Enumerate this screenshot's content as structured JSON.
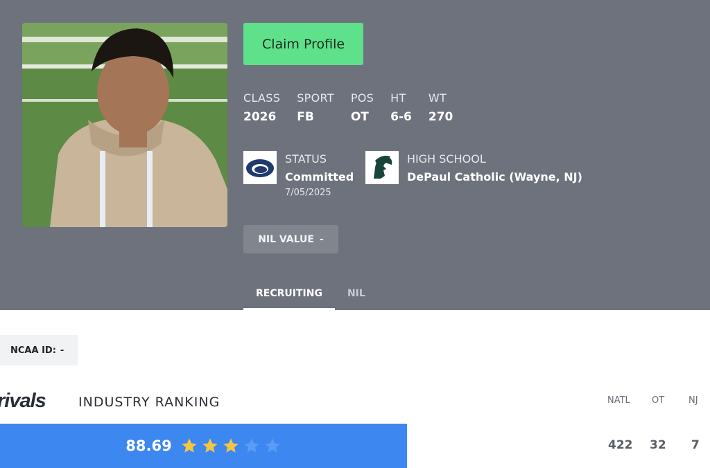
{
  "profile": {
    "claim_label": "Claim Profile",
    "attributes": [
      {
        "label": "CLASS",
        "value": "2026"
      },
      {
        "label": "SPORT",
        "value": "FB"
      },
      {
        "label": "POS",
        "value": "OT"
      },
      {
        "label": "HT",
        "value": "6-6"
      },
      {
        "label": "WT",
        "value": "270"
      }
    ],
    "status": {
      "label": "STATUS",
      "value": "Committed",
      "date": "7/05/2025",
      "logo": "penn-state-logo"
    },
    "high_school": {
      "label": "HIGH SCHOOL",
      "value": "DePaul Catholic (Wayne, NJ)",
      "logo": "spartan-logo"
    },
    "nil": {
      "label": "NIL VALUE",
      "value": "-"
    }
  },
  "tabs": [
    {
      "label": "RECRUITING",
      "active": true
    },
    {
      "label": "NIL",
      "active": false
    }
  ],
  "ncaa": {
    "label": "NCAA ID:",
    "value": "-"
  },
  "ranking": {
    "brand": "rivals",
    "title": "INDUSTRY RANKING",
    "rating": "88.69",
    "stars_filled": 3,
    "stars_total": 5,
    "columns": [
      {
        "label": "NATL",
        "value": "422"
      },
      {
        "label": "OT",
        "value": "32"
      },
      {
        "label": "NJ",
        "value": "7"
      }
    ]
  },
  "colors": {
    "header_bg": "#6d727c",
    "claim_button": "#5fe08a",
    "rating_bar": "#3d87f0",
    "star_filled": "#f5c542",
    "star_empty": "#5a9bf5"
  }
}
